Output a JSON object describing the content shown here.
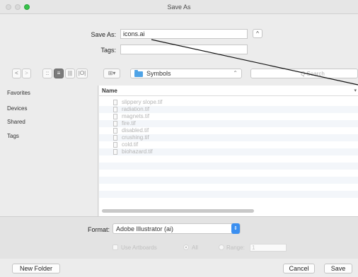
{
  "window": {
    "title": "Save As"
  },
  "save": {
    "save_as_label": "Save As:",
    "filename": "icons.ai",
    "tags_label": "Tags:",
    "tags_value": "",
    "expand_glyph": "^"
  },
  "toolbar": {
    "back_glyph": "<",
    "forward_glyph": ">",
    "view_icons_glyph": "::",
    "view_list_glyph": "≡",
    "view_columns_glyph": "|||",
    "view_cover_glyph": "|O|",
    "arrange_glyph": "⊞▾",
    "location": "Symbols",
    "location_stepper": "⌃",
    "search_placeholder": "Q Search"
  },
  "sidebar": {
    "items": [
      {
        "label": "Favorites"
      },
      {
        "label": "Devices"
      },
      {
        "label": "Shared"
      },
      {
        "label": "Tags"
      }
    ]
  },
  "list": {
    "column_name": "Name",
    "sort_caret": "▾",
    "files": [
      {
        "name": "slippery slope.tif"
      },
      {
        "name": "radiation.tif"
      },
      {
        "name": "magnets.tif"
      },
      {
        "name": "fire.tif"
      },
      {
        "name": "disabled.tif"
      },
      {
        "name": "crushing.tif"
      },
      {
        "name": "cold.tif"
      },
      {
        "name": "biohazard.tif"
      }
    ]
  },
  "options": {
    "format_label": "Format:",
    "format_value": "Adobe Illustrator (ai)",
    "use_artboards": "Use Artboards",
    "all_label": "All",
    "range_label": "Range:",
    "range_value": "1"
  },
  "footer": {
    "new_folder": "New Folder",
    "cancel": "Cancel",
    "save": "Save"
  },
  "colors": {
    "accent": "#3b8ff0",
    "folder": "#4fa3e6",
    "zoom_button": "#36c24a"
  }
}
